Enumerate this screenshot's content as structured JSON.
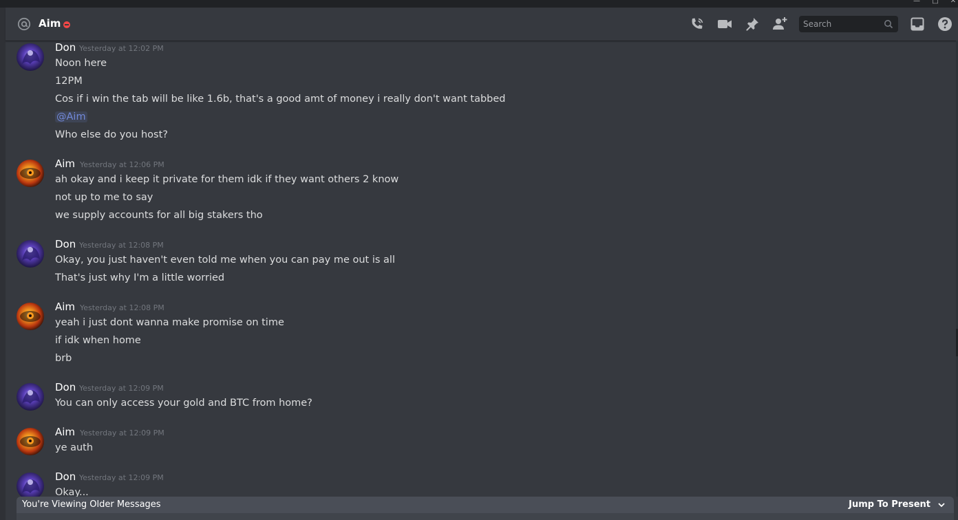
{
  "window": {
    "minimize": "—",
    "maximize": "□",
    "close": "✕"
  },
  "header": {
    "channel": "Aim",
    "status": "do-not-disturb",
    "search_placeholder": "Search",
    "icons": [
      "start-voice-call-icon",
      "start-video-call-icon",
      "pinned-messages-icon",
      "add-friends-icon",
      "inbox-icon",
      "help-icon"
    ]
  },
  "messages": [
    {
      "author": "Don",
      "timestamp": "Yesterday at 12:02 PM",
      "avatar": "don-avatar",
      "lines": [
        "Noon here",
        "12PM",
        "Cos if i win the tab will be like 1.6b, that's a good amt of money i really don't want tabbed",
        "@Aim",
        "Who else do you host?"
      ]
    },
    {
      "author": "Aim",
      "timestamp": "Yesterday at 12:06 PM",
      "avatar": "aim-avatar",
      "lines": [
        "ah okay and i keep it private for them idk if they want others 2 know",
        "not up to me to say",
        "we supply accounts for all big stakers tho"
      ]
    },
    {
      "author": "Don",
      "timestamp": "Yesterday at 12:08 PM",
      "avatar": "don-avatar",
      "lines": [
        "Okay, you just haven't even told me when you can pay me out is all",
        "That's just why I'm a little worried"
      ]
    },
    {
      "author": "Aim",
      "timestamp": "Yesterday at 12:08 PM",
      "avatar": "aim-avatar",
      "lines": [
        "yeah i just dont wanna make promise on time",
        "if idk when home",
        "brb"
      ]
    },
    {
      "author": "Don",
      "timestamp": "Yesterday at 12:09 PM",
      "avatar": "don-avatar",
      "lines": [
        "You can only access your gold and BTC from home?"
      ]
    },
    {
      "author": "Aim",
      "timestamp": "Yesterday at 12:09 PM",
      "avatar": "aim-avatar",
      "lines": [
        "ye auth"
      ]
    },
    {
      "author": "Don",
      "timestamp": "Yesterday at 12:09 PM",
      "avatar": "don-avatar",
      "lines": [
        "Okay..."
      ]
    }
  ],
  "footer": {
    "older_notice": "You're Viewing Older Messages",
    "jump_label": "Jump To Present"
  },
  "colors": {
    "background": "#36393f",
    "mention": "#7289da",
    "dnd": "#f04747",
    "timestamp": "#72767d"
  }
}
